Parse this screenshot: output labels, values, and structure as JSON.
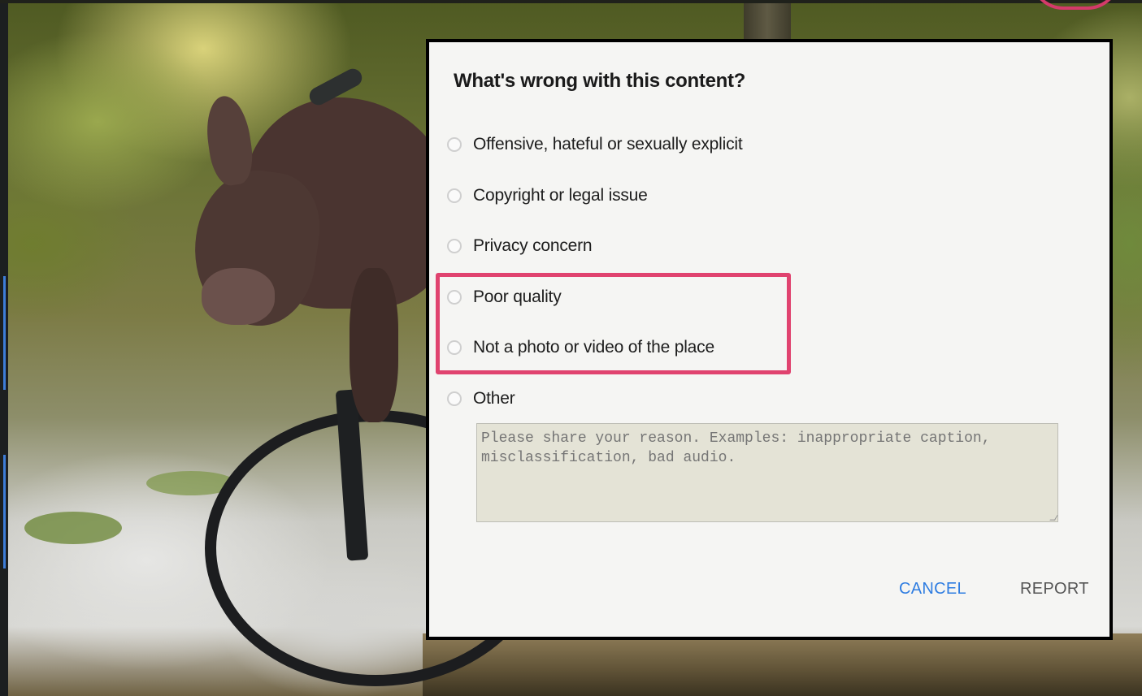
{
  "dialog": {
    "title": "What's wrong with this content?",
    "options": [
      {
        "label": "Offensive, hateful or sexually explicit"
      },
      {
        "label": "Copyright or legal issue"
      },
      {
        "label": "Privacy concern"
      },
      {
        "label": "Poor quality"
      },
      {
        "label": "Not a photo or video of the place"
      },
      {
        "label": "Other"
      }
    ],
    "reason_placeholder": "Please share your reason. Examples: inappropriate caption, misclassification, bad audio.",
    "cancel_label": "CANCEL",
    "report_label": "REPORT"
  },
  "colors": {
    "highlight": "#e0436f",
    "cancel": "#2f7de1",
    "report": "#555555"
  }
}
